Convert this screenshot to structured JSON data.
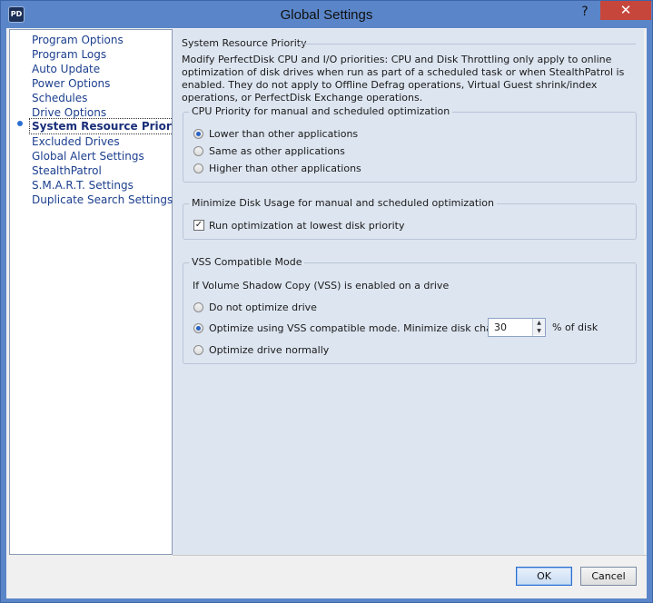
{
  "window": {
    "title": "Global Settings",
    "icon_text": "PD",
    "help_glyph": "?",
    "close_glyph": "✕"
  },
  "nav": {
    "items": [
      "Program Options",
      "Program Logs",
      "Auto Update",
      "Power Options",
      "Schedules",
      "Drive Options",
      "System Resource Priority",
      "Excluded Drives",
      "Global Alert Settings",
      "StealthPatrol",
      "S.M.A.R.T. Settings",
      "Duplicate Search Settings"
    ],
    "selected": "System Resource Priority"
  },
  "section": {
    "title": "System Resource Priority",
    "description": "Modify PerfectDisk CPU and I/O priorities: CPU and Disk Throttling only apply to online optimization of disk drives when run as part of a scheduled task or when StealthPatrol is enabled.  They do not apply to Offline Defrag operations, Virtual Guest shrink/index operations, or PerfectDisk Exchange operations."
  },
  "cpu_group": {
    "title": "CPU Priority for manual and scheduled optimization",
    "options": [
      {
        "label": "Lower than other applications",
        "checked": true
      },
      {
        "label": "Same as other applications",
        "checked": false
      },
      {
        "label": "Higher than other applications",
        "checked": false
      }
    ]
  },
  "disk_group": {
    "title": "Minimize Disk Usage for manual and scheduled optimization",
    "checkbox_label": "Run optimization at lowest disk priority",
    "checked": true,
    "check_glyph": "✓"
  },
  "vss_group": {
    "title": "VSS Compatible Mode",
    "intro": "If Volume Shadow Copy (VSS) is enabled on a drive",
    "options": [
      {
        "label": "Do not optimize drive",
        "checked": false
      },
      {
        "label": "Optimize using VSS compatible mode.  Minimize disk changes to",
        "checked": true
      },
      {
        "label": "Optimize drive normally",
        "checked": false
      }
    ],
    "spin_value": "30",
    "spin_suffix": "% of disk",
    "spin_up": "▲",
    "spin_down": "▼"
  },
  "buttons": {
    "ok": "OK",
    "cancel": "Cancel"
  },
  "colors": {
    "frame": "#5a86c9",
    "close_button": "#c7463c",
    "content_bg": "#dde5f0",
    "nav_link": "#1c3f8e"
  }
}
